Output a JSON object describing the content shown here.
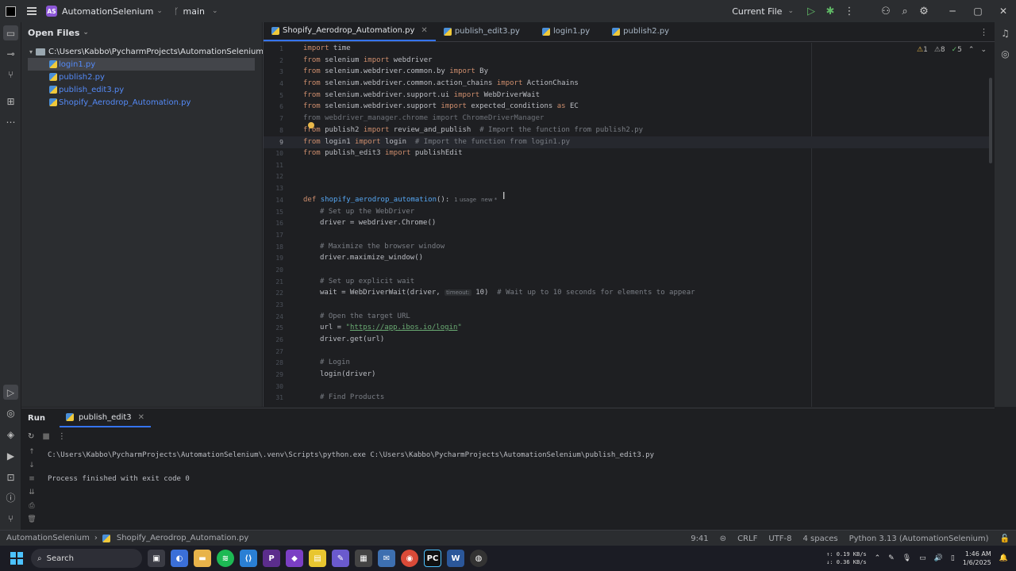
{
  "titlebar": {
    "project_badge": "AS",
    "project_name": "AutomationSelenium",
    "branch": "main",
    "run_config": "Current File"
  },
  "project_panel": {
    "header": "Open Files",
    "root": "C:\\Users\\Kabbo\\PycharmProjects\\AutomationSelenium",
    "files": [
      "login1.py",
      "publish2.py",
      "publish_edit3.py",
      "Shopify_Aerodrop_Automation.py"
    ]
  },
  "editor": {
    "tabs": [
      "Shopify_Aerodrop_Automation.py",
      "publish_edit3.py",
      "login1.py",
      "publish2.py"
    ],
    "inspections": {
      "warnings": "1",
      "weak": "8",
      "typos": "5"
    },
    "current_line": 9
  },
  "code": {
    "l1": [
      "import",
      " time"
    ],
    "l2": [
      "from",
      " selenium ",
      "import",
      " webdriver"
    ],
    "l3": [
      "from",
      " selenium.webdriver.common.by ",
      "import",
      " By"
    ],
    "l4": [
      "from",
      " selenium.webdriver.common.action_chains ",
      "import",
      " ActionChains"
    ],
    "l5": [
      "from",
      " selenium.webdriver.support.ui ",
      "import",
      " WebDriverWait"
    ],
    "l6": [
      "from",
      " selenium.webdriver.support ",
      "import",
      " expected_conditions ",
      "as",
      " EC"
    ],
    "l7": "from webdriver_manager.chrome import ChromeDriverManager",
    "l8": [
      "from",
      " publish2 ",
      "import",
      " review_and_publish  ",
      "# Import the function from publish2.py"
    ],
    "l9": [
      "from",
      " login1 ",
      "import",
      " login  ",
      "# Import the function from login1.py"
    ],
    "l10": [
      "from",
      " publish_edit3 ",
      "import",
      " publishEdit"
    ],
    "l14": [
      "def",
      " ",
      "shopify_aerodrop_automation",
      "():",
      "1 usage",
      "new *"
    ],
    "l15": "# Set up the WebDriver",
    "l16": "driver = webdriver.Chrome()",
    "l18": "# Maximize the browser window",
    "l19": "driver.maximize_window()",
    "l21": "# Set up explicit wait",
    "l22": [
      "wait = WebDriverWait(driver, ",
      "timeout:",
      " 10)  ",
      "# Wait up to 10 seconds for elements to appear"
    ],
    "l24": "# Open the target URL",
    "l25": [
      "url = ",
      "\"",
      "https://app.ibos.io/login",
      "\""
    ],
    "l26": "driver.get(url)",
    "l28": "# Login",
    "l29": "login(driver)",
    "l31": "# Find Products"
  },
  "run_panel": {
    "title": "Run",
    "tab": "publish_edit3",
    "console": [
      "C:\\Users\\Kabbo\\PycharmProjects\\AutomationSelenium\\.venv\\Scripts\\python.exe C:\\Users\\Kabbo\\PycharmProjects\\AutomationSelenium\\publish_edit3.py",
      "",
      "Process finished with exit code 0"
    ]
  },
  "statusbar": {
    "breadcrumb_project": "AutomationSelenium",
    "breadcrumb_file": "Shopify_Aerodrop_Automation.py",
    "position": "9:41",
    "line_sep": "CRLF",
    "encoding": "UTF-8",
    "indent": "4 spaces",
    "interpreter": "Python 3.13 (AutomationSelenium)"
  },
  "taskbar": {
    "search": "Search",
    "net_up": "↑: 0.19 KB/s",
    "net_down": "↓: 0.36 KB/s",
    "time": "1:46 AM",
    "date": "1/6/2025"
  },
  "colors": {
    "accent": "#3574f0",
    "keyword": "#cf8e6d",
    "function": "#56a8f5",
    "comment": "#7a7e85",
    "string": "#6aab73"
  }
}
